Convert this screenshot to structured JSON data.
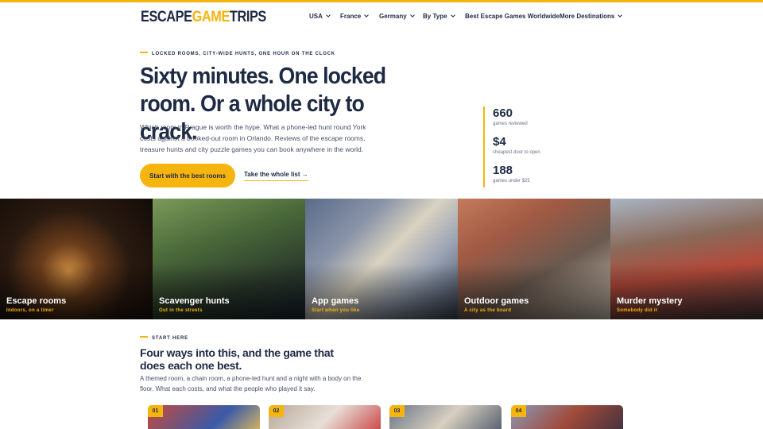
{
  "logo": {
    "part1": "ESCAPE",
    "part2": "GAME",
    "part3": "TRIPS"
  },
  "nav": [
    {
      "label": "USA",
      "dropdown": true
    },
    {
      "label": "France",
      "dropdown": true
    },
    {
      "label": "Germany",
      "dropdown": true
    },
    {
      "label": "By Type",
      "dropdown": true
    },
    {
      "label": "Best Escape Games Worldwide",
      "dropdown": false
    },
    {
      "label": "More Destinations",
      "dropdown": true
    }
  ],
  "hero": {
    "eyebrow": "LOCKED ROOMS, CITY-WIDE HUNTS, ONE HOUR ON THE CLOCK",
    "title": "Sixty minutes. One locked room. Or a whole city to crack.",
    "description": "Which room in Prague is worth the hype. What a phone-led hunt round York costs against a booked-out room in Orlando. Reviews of the escape rooms, treasure hunts and city puzzle games you can book anywhere in the world.",
    "cta_label": "Start with the best rooms",
    "link_label": "Take the whole list →"
  },
  "stats": [
    {
      "value": "660",
      "label": "games reviewed"
    },
    {
      "value": "$4",
      "label": "cheapest door to open"
    },
    {
      "value": "188",
      "label": "games under $25"
    }
  ],
  "tiles": [
    {
      "name": "Escape rooms",
      "sub": "Indoors, on a timer"
    },
    {
      "name": "Scavenger hunts",
      "sub": "Out in the streets"
    },
    {
      "name": "App games",
      "sub": "Start when you like"
    },
    {
      "name": "Outdoor games",
      "sub": "A city as the board"
    },
    {
      "name": "Murder mystery",
      "sub": "Somebody did it"
    }
  ],
  "section": {
    "eyebrow": "START HERE",
    "title": "Four ways into this, and the game that does each one best.",
    "description": "A themed room, a chain room, a phone-led hunt and a night with a body on the floor. What each costs, and what the people who played it say."
  },
  "cards": [
    {
      "num": "01"
    },
    {
      "num": "02"
    },
    {
      "num": "03"
    },
    {
      "num": "04"
    }
  ],
  "colors": {
    "accent": "#f6b40e",
    "navy": "#1e2a44"
  }
}
